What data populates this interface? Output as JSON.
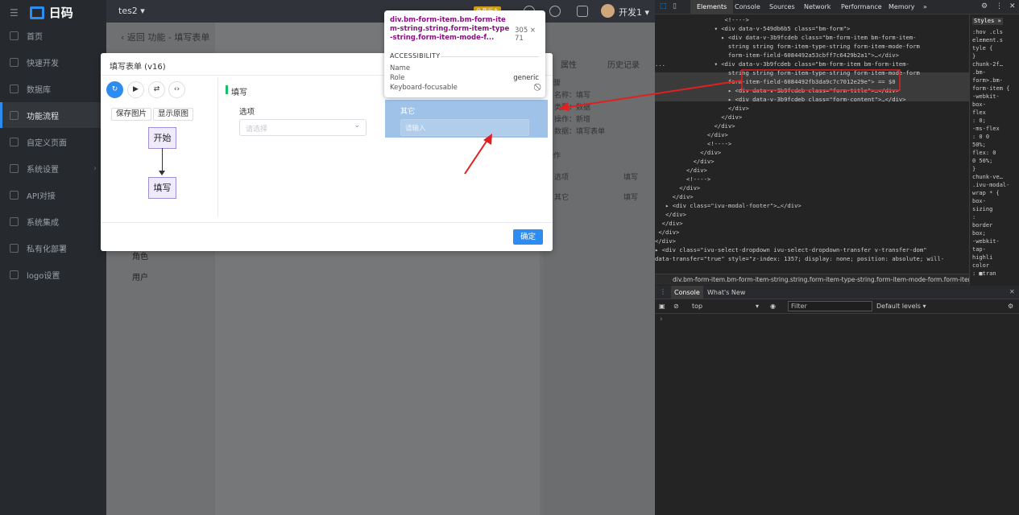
{
  "app": {
    "logo": "日码",
    "project": "tes2 ▾",
    "user": "开发1 ▾",
    "badge": "免费版本"
  },
  "sidebar": {
    "items": [
      {
        "label": "首页"
      },
      {
        "label": "快速开发"
      },
      {
        "label": "数据库"
      },
      {
        "label": "功能流程"
      },
      {
        "label": "自定义页面"
      },
      {
        "label": "系统设置"
      },
      {
        "label": "API对接"
      },
      {
        "label": "系统集成"
      },
      {
        "label": "私有化部署"
      },
      {
        "label": "logo设置"
      }
    ]
  },
  "main": {
    "breadcrumb": "‹ 返回   功能 - 填写表单",
    "tree": [
      "角色",
      "用户"
    ],
    "right_tabs": [
      "属性",
      "历史记录"
    ],
    "right_lines": [
      "步骤",
      "名称：填写",
      "类型：数据",
      "操作：新增",
      "数据：填写表单",
      "操作",
      "选项",
      "填写",
      "其它",
      "填写"
    ]
  },
  "modal": {
    "title": "填写表单 (v16)",
    "save_img": "保存图片",
    "show_img": "显示原图",
    "node_start": "开始",
    "node_fill": "填写",
    "section_title": "填写",
    "field_label": "选项",
    "field_placeholder": "请选择",
    "other_label": "其它",
    "other_placeholder": "请输入",
    "ok": "确定",
    "tools": [
      "↻",
      "▶",
      "⇄",
      "‹›"
    ]
  },
  "tooltip": {
    "selector": "div.bm-form-item.bm-form-item-string.string.form-item-type-string.form-item-mode-f...",
    "size": "305 × 71",
    "section": "ACCESSIBILITY",
    "name_key": "Name",
    "role_key": "Role",
    "role_val": "generic",
    "kf_key": "Keyboard-focusable",
    "kf_val": "⃠"
  },
  "devtools": {
    "tabs": [
      "Elements",
      "Console",
      "Sources",
      "Network",
      "Performance",
      "Memory",
      "»"
    ],
    "code": [
      "                    <!---->",
      "                 ▾ <div data-v-549db6b5 class=\"bm-form\">",
      "                   ▸ <div data-v-3b9fcdeb class=\"bm-form-item bm-form-item-",
      "                     string string form-item-type-string form-item-mode-form",
      "                     form-item-field-6084492a53cbff7c6429b2a1\">…</div>",
      "...              ▾ <div data-v-3b9fcdeb class=\"bm-form-item bm-form-item-",
      "                     string string form-item-type-string form-item-mode-form",
      "                     form-item-field-6084492fb3da9c7c7012e29e\"> == $0",
      "                     ▸ <div data-v-3b9fcdeb class=\"form-title\">…</div>",
      "                     ▸ <div data-v-3b9fcdeb class=\"form-content\">…</div>",
      "                     </div>",
      "                   </div>",
      "                 </div>",
      "               </div>",
      "               <!---->",
      "             </div>",
      "           </div>",
      "         </div>",
      "         <!---->",
      "       </div>",
      "     </div>",
      "   ▸ <div class=\"ivu-modal-footer\">…</div>",
      "   </div>",
      "  </div>",
      " </div>",
      "</div>",
      "▸ <div class=\"ivu-select-dropdown ivu-select-dropdown-transfer v-transfer-dom\"",
      "data-transfer=\"true\" style=\"z-index: 1357; display: none; position: absolute; will-"
    ],
    "breadcrumb": "div.bm-form-item.bm-form-item-string.string.form-item-type-string.form-item-mode-form.form-iter …",
    "styles": {
      "tabs": "Styles  »",
      "lines": [
        ":hov .cls",
        "element.s",
        "tyle {",
        "}",
        "chunk-2f…",
        ".bm-",
        "form>.bm-",
        "form-item {",
        "  -webkit-",
        "   box-",
        "   flex",
        ":  0;",
        "  -ms-flex",
        ":  0 0",
        "   50%;",
        "  flex: 0",
        "   0 50%;",
        "}",
        "chunk-ve…",
        ".ivu-modal-",
        "wrap * {",
        "  box-",
        "   sizing",
        ":",
        "   border",
        "   box;",
        "  -webkit-",
        "   tap-",
        "   highli",
        "   color",
        ":  ■tran"
      ]
    },
    "console": {
      "tabs": [
        "Console",
        "What's New"
      ],
      "context": "top",
      "filter": "Filter",
      "levels": "Default levels ▾",
      "prompt": "›"
    }
  }
}
